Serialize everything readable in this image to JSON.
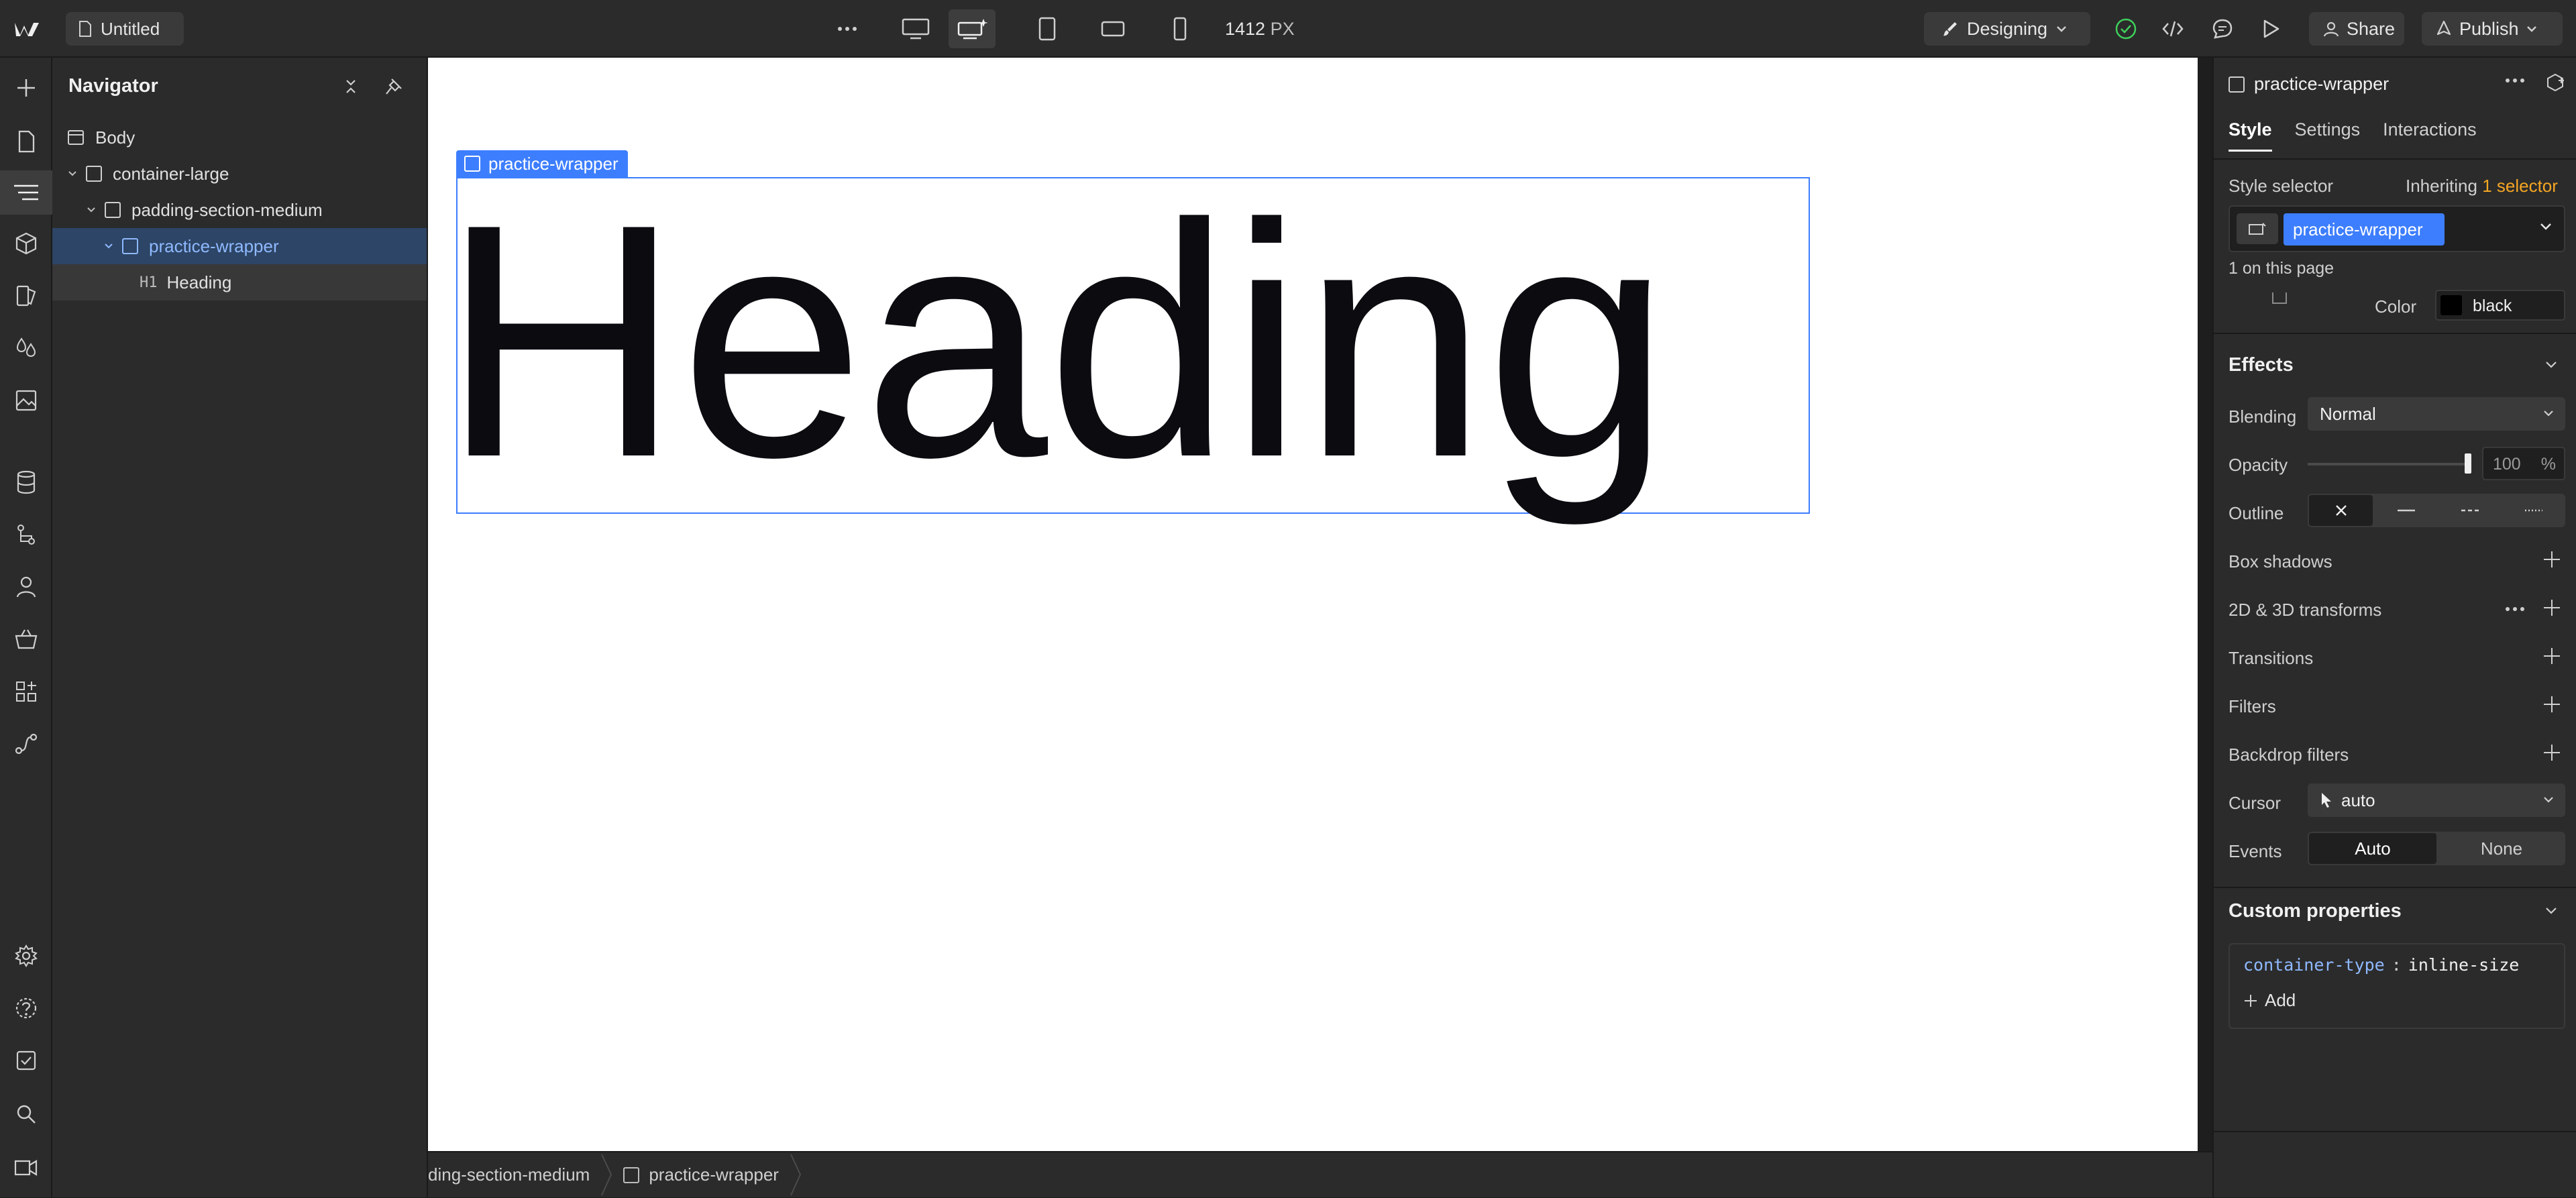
{
  "topbar": {
    "project_name": "Untitled",
    "width_value": "1412",
    "width_unit": "PX",
    "mode": "Designing",
    "share_label": "Share",
    "publish_label": "Publish"
  },
  "navigator": {
    "title": "Navigator",
    "items": [
      {
        "label": "Body",
        "type": "body"
      },
      {
        "label": "container-large",
        "type": "div"
      },
      {
        "label": "padding-section-medium",
        "type": "div"
      },
      {
        "label": "practice-wrapper",
        "type": "div"
      },
      {
        "label": "Heading",
        "type": "H1",
        "tag": "H1"
      }
    ]
  },
  "canvas": {
    "selection_label": "practice-wrapper",
    "heading_text": "Heading"
  },
  "breadcrumb": {
    "items": [
      "ding-section-medium",
      "practice-wrapper"
    ]
  },
  "panel": {
    "element_name": "practice-wrapper",
    "tabs": [
      "Style",
      "Settings",
      "Interactions"
    ],
    "style_selector_label": "Style selector",
    "inheriting_label": "Inheriting",
    "inheriting_count": "1 selector",
    "selector_chip": "practice-wrapper",
    "on_page_count": "1 on this page",
    "color_label": "Color",
    "color_value": "black",
    "effects": {
      "title": "Effects",
      "blending_label": "Blending",
      "blending_value": "Normal",
      "opacity_label": "Opacity",
      "opacity_value": "100",
      "opacity_unit": "%",
      "outline_label": "Outline",
      "box_shadows_label": "Box shadows",
      "transforms_label": "2D & 3D transforms",
      "transitions_label": "Transitions",
      "filters_label": "Filters",
      "backdrop_filters_label": "Backdrop filters",
      "cursor_label": "Cursor",
      "cursor_value": "auto",
      "events_label": "Events",
      "events_options": [
        "Auto",
        "None"
      ]
    },
    "custom_properties": {
      "title": "Custom properties",
      "property_name": "container-type",
      "separator": ":",
      "property_value": "inline-size",
      "add_label": "Add"
    }
  },
  "colors": {
    "accent": "#3d7eff",
    "inheriting_accent": "#f5a623",
    "panel_bg": "#2b2b2b",
    "canvas_bg": "#ffffff",
    "success": "#3fcf5b"
  }
}
